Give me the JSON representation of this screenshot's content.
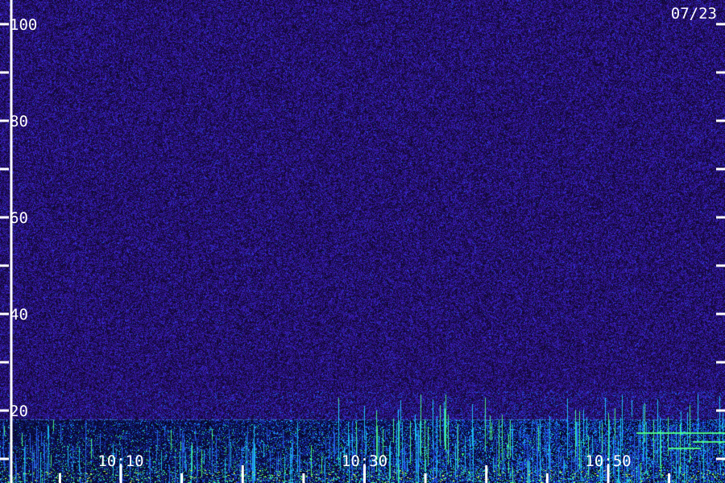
{
  "chart_data": {
    "type": "heatmap",
    "date_label": "07/23",
    "y_ticks": [
      {
        "value": 100,
        "label": "100"
      },
      {
        "value": 80,
        "label": "80"
      },
      {
        "value": 60,
        "label": "60"
      },
      {
        "value": 40,
        "label": "40"
      },
      {
        "value": 20,
        "label": "20"
      }
    ],
    "y_minor_ticks": [
      90,
      70,
      50,
      30,
      10
    ],
    "ylim": [
      5,
      105
    ],
    "x_ticks": [
      {
        "value": "10:10",
        "label": "10:10"
      },
      {
        "value": "10:30",
        "label": "10:30"
      },
      {
        "value": "10:50",
        "label": "10:50"
      }
    ],
    "x_time_range": [
      "09:55",
      "11:05"
    ],
    "marker_time": "10:01",
    "colors": {
      "background": "#1a0a3d",
      "noise": "#3a1fb0",
      "low": "#1e50e0",
      "mid": "#19c7ff",
      "high": "#3cff7a",
      "axis": "#ffffff"
    }
  }
}
